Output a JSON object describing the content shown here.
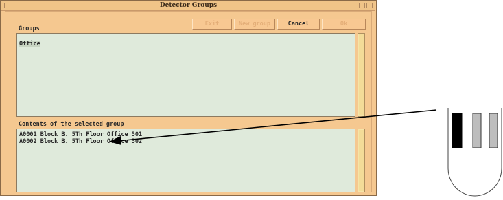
{
  "window": {
    "title": "Detector Groups"
  },
  "toolbar": {
    "buttons": [
      {
        "label": "Exit",
        "enabled": false
      },
      {
        "label": "New group",
        "enabled": false
      },
      {
        "label": "Cancel",
        "enabled": true
      },
      {
        "label": "Ok",
        "enabled": false
      }
    ]
  },
  "groups": {
    "label": "Groups",
    "items": [
      "Office"
    ],
    "selected": "Office"
  },
  "contents": {
    "label": "Contents of the selected group",
    "items": [
      "A0001 Block B. 5Th Floor Office 501",
      "A0002 Block B. 5Th Floor Office 502"
    ]
  },
  "colors": {
    "window_bg": "#f5c890",
    "list_bg": "#dfeadb",
    "scrollbar": "#f6e4a8"
  },
  "icons": [
    "menu-icon",
    "minimize-icon",
    "maximize-icon",
    "detector-device-icon",
    "pointer-arrow"
  ]
}
